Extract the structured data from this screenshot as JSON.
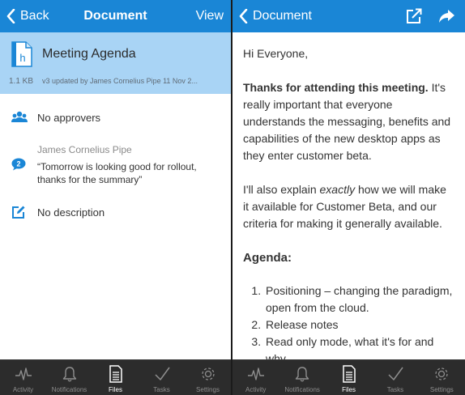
{
  "left": {
    "nav": {
      "back_label": "Back",
      "title": "Document",
      "view_label": "View"
    },
    "document": {
      "name": "Meeting Agenda",
      "size": "1.1 KB",
      "version_text": "v3 updated by James Cornelius Pipe 11 Nov 2...",
      "file_icon": "document-file-icon",
      "file_glyph": "h"
    },
    "approvers": {
      "icon": "people-icon",
      "text": "No approvers"
    },
    "comment": {
      "icon": "comment-count-icon",
      "count": "2",
      "author": "James Cornelius Pipe",
      "text": "“Tomorrow is looking good for rollout, thanks for the summary”"
    },
    "description": {
      "icon": "edit-icon",
      "text": "No description"
    }
  },
  "right": {
    "nav": {
      "back_label": "Document",
      "icons": [
        "open-external-icon",
        "share-icon"
      ]
    },
    "body": {
      "greeting": "Hi Everyone,",
      "p1_bold": "Thanks for attending this meeting.",
      "p1_rest": " It's really important that everyone understands the messaging, benefits and capabilities of the new desktop apps as they enter customer beta.",
      "p2_a": "I'll also explain ",
      "p2_em": "exactly",
      "p2_b": " how we will make it available for Customer Beta, and our criteria for making it generally available.",
      "agenda_heading": "Agenda:",
      "agenda_items": [
        "Positioning – changing the paradigm, open from the cloud.",
        "Release notes",
        "Read only mode, what it's for and why"
      ]
    }
  },
  "tabbar": {
    "tabs": [
      {
        "label": "Activity",
        "icon": "activity-icon"
      },
      {
        "label": "Notifications",
        "icon": "bell-icon"
      },
      {
        "label": "Files",
        "icon": "files-icon",
        "active": true
      },
      {
        "label": "Tasks",
        "icon": "checkmark-icon"
      },
      {
        "label": "Settings",
        "icon": "gear-icon"
      }
    ]
  },
  "colors": {
    "nav_bg": "#1a86d6",
    "header_bg": "#a9d4f5",
    "tabbar_bg": "#2c2c2c",
    "icon_blue": "#1a86d6"
  }
}
